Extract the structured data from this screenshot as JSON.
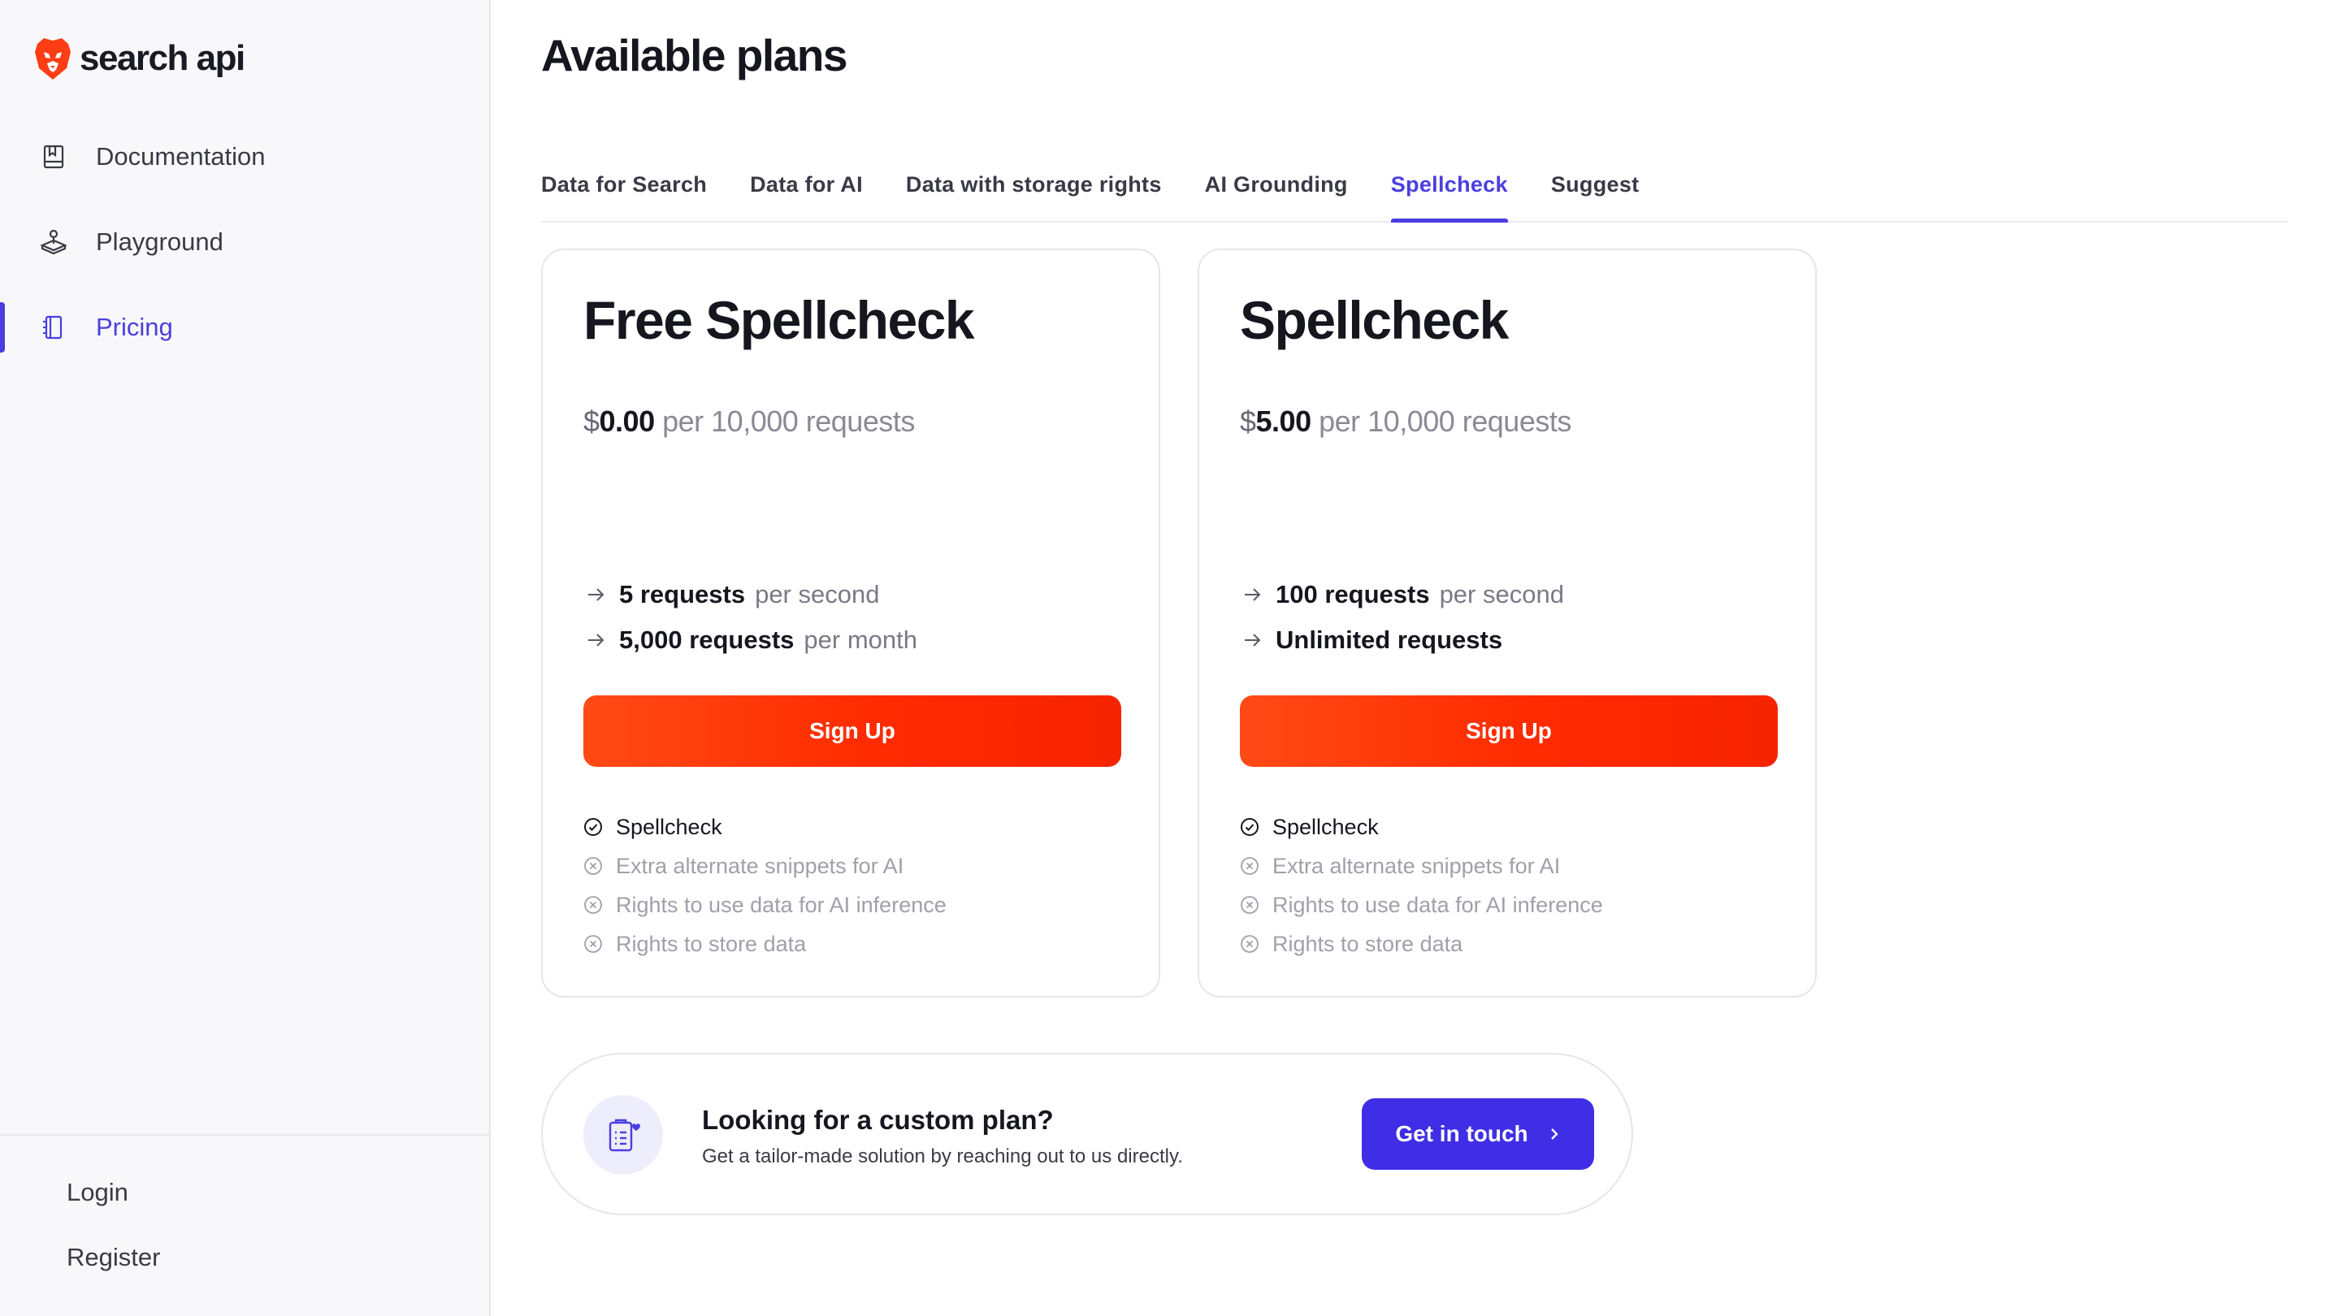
{
  "brand": {
    "name": "search api",
    "accent": "#4a3ee0",
    "logo_color": "#ff3d14"
  },
  "sidebar": {
    "items": [
      {
        "label": "Documentation",
        "icon": "book-icon"
      },
      {
        "label": "Playground",
        "icon": "joystick-icon"
      },
      {
        "label": "Pricing",
        "icon": "notebook-icon",
        "active": true
      }
    ],
    "login": "Login",
    "register": "Register"
  },
  "main": {
    "title": "Available plans",
    "tabs": [
      {
        "label": "Data for Search"
      },
      {
        "label": "Data for AI"
      },
      {
        "label": "Data with storage rights"
      },
      {
        "label": "AI Grounding"
      },
      {
        "label": "Spellcheck",
        "active": true
      },
      {
        "label": "Suggest"
      }
    ],
    "plans": [
      {
        "title": "Free Spellcheck",
        "currency": "$",
        "amount": "0.00",
        "unit": "per 10,000 requests",
        "features": [
          {
            "strong": "5 requests",
            "muted": "per second"
          },
          {
            "strong": "5,000 requests",
            "muted": "per month"
          }
        ],
        "button": "Sign Up",
        "checks": [
          {
            "label": "Spellcheck",
            "included": true
          },
          {
            "label": "Extra alternate snippets for AI",
            "included": false
          },
          {
            "label": "Rights to use data for AI inference",
            "included": false
          },
          {
            "label": "Rights to store data",
            "included": false
          }
        ]
      },
      {
        "title": "Spellcheck",
        "currency": "$",
        "amount": "5.00",
        "unit": "per 10,000 requests",
        "features": [
          {
            "strong": "100 requests",
            "muted": "per second"
          },
          {
            "strong": "Unlimited requests",
            "muted": ""
          }
        ],
        "button": "Sign Up",
        "checks": [
          {
            "label": "Spellcheck",
            "included": true
          },
          {
            "label": "Extra alternate snippets for AI",
            "included": false
          },
          {
            "label": "Rights to use data for AI inference",
            "included": false
          },
          {
            "label": "Rights to store data",
            "included": false
          }
        ]
      }
    ],
    "custom": {
      "title": "Looking for a custom plan?",
      "subtitle": "Get a tailor-made solution by reaching out to us directly.",
      "button": "Get in touch",
      "icon": "clipboard-heart-icon"
    }
  }
}
